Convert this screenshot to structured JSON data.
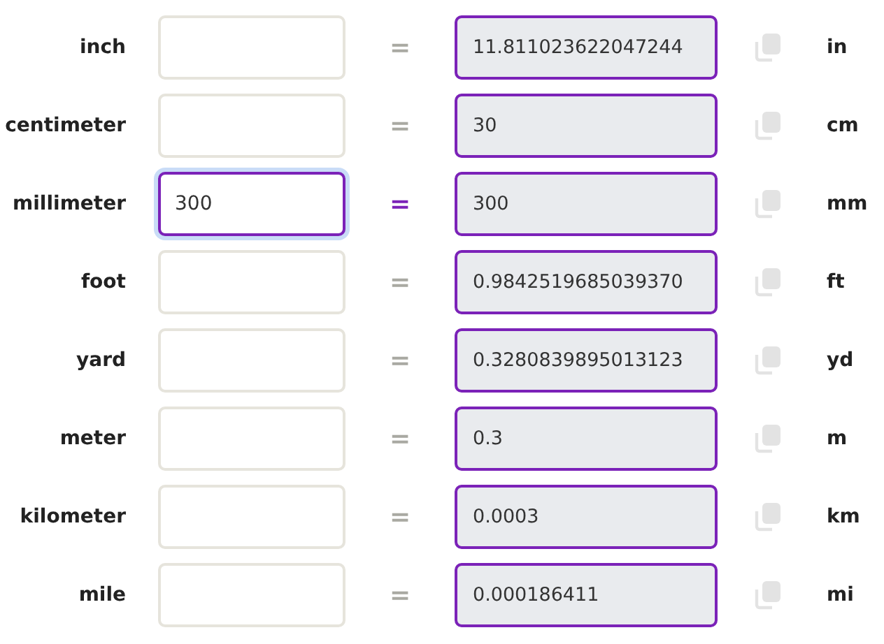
{
  "rows": [
    {
      "label": "inch",
      "input": "",
      "focused": false,
      "equals": "=",
      "result": "11.811023622047244",
      "unit": "in"
    },
    {
      "label": "centimeter",
      "input": "",
      "focused": false,
      "equals": "=",
      "result": "30",
      "unit": "cm"
    },
    {
      "label": "millimeter",
      "input": "300",
      "focused": true,
      "equals": "=",
      "result": "300",
      "unit": "mm"
    },
    {
      "label": "foot",
      "input": "",
      "focused": false,
      "equals": "=",
      "result": "0.9842519685039370",
      "unit": "ft"
    },
    {
      "label": "yard",
      "input": "",
      "focused": false,
      "equals": "=",
      "result": "0.3280839895013123",
      "unit": "yd"
    },
    {
      "label": "meter",
      "input": "",
      "focused": false,
      "equals": "=",
      "result": "0.3",
      "unit": "m"
    },
    {
      "label": "kilometer",
      "input": "",
      "focused": false,
      "equals": "=",
      "result": "0.0003",
      "unit": "km"
    },
    {
      "label": "mile",
      "input": "",
      "focused": false,
      "equals": "=",
      "result": "0.000186411",
      "unit": "mi"
    }
  ]
}
